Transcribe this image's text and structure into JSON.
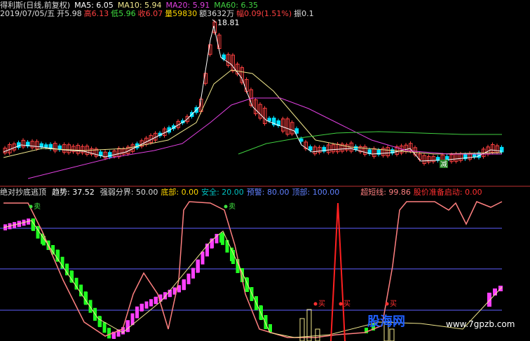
{
  "header": {
    "stock_title": "得利斯(日线,前复权)",
    "ma5": "MA5: 6.05",
    "ma10": "MA10: 5.94",
    "ma20": "MA20: 5.91",
    "ma60": "MA60: 6.35"
  },
  "quote": {
    "date": "2019/07/05/五",
    "open": "开5.98",
    "high": "高6.13",
    "low": "低5.96",
    "close": "收6.07",
    "volume": "量59830",
    "amount": "额3632万",
    "change": "幅0.09(1.51%)",
    "amplitude": "振0.1"
  },
  "price_chart": {
    "peak_label": "18.81",
    "event_label": "减"
  },
  "indicator": {
    "name": "绝对抄底逃顶",
    "trend": "趋势: 37.52",
    "strong_weak": "强弱分界: 50.00",
    "bottom": "底部: 0.00",
    "safe": "安全: 20.00",
    "warning": "预警: 80.00",
    "top": "顶部: 100.00",
    "super_short": "超短线: 99.86",
    "price_start": "股价准备启动: 0.00",
    "sell_label": "卖",
    "buy_label": "买"
  },
  "watermark": {
    "logo": "股海网",
    "url": "www.7gpzb.com"
  },
  "colors": {
    "bg": "#000000",
    "up": "#ff4040",
    "down": "#00e0ff",
    "ma5": "#ffffff",
    "ma10": "#f0e68c",
    "ma20": "#e040e0",
    "ma60": "#40d040",
    "trend_line": "#ff8080",
    "buy_bar": "#ff40ff",
    "sell_bar": "#20ff20"
  }
}
